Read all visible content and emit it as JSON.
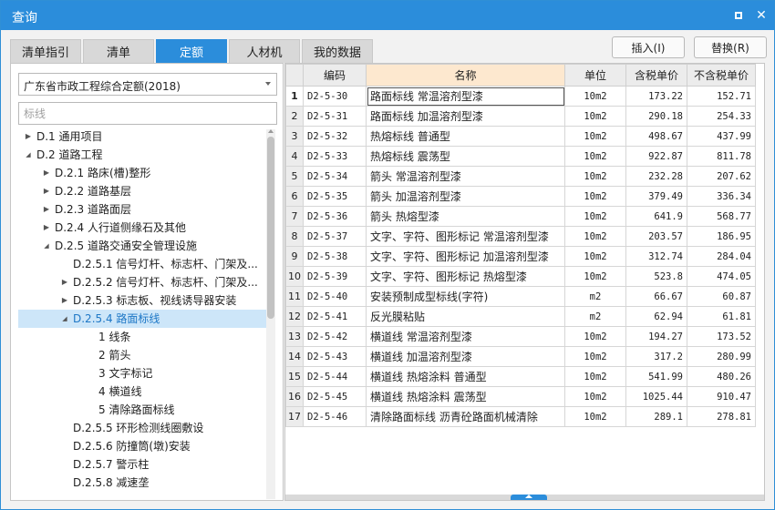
{
  "window": {
    "title": "查询"
  },
  "tabs": [
    {
      "label": "清单指引",
      "active": false
    },
    {
      "label": "清单",
      "active": false
    },
    {
      "label": "定额",
      "active": true
    },
    {
      "label": "人材机",
      "active": false
    },
    {
      "label": "我的数据",
      "active": false
    }
  ],
  "actions": {
    "insert_label": "插入(I)",
    "replace_label": "替换(R)"
  },
  "library": {
    "selected": "广东省市政工程综合定额(2018)"
  },
  "filter": {
    "placeholder": "标线"
  },
  "tree": [
    {
      "label": "D.1 通用项目",
      "level": 0,
      "arrow": "right"
    },
    {
      "label": "D.2 道路工程",
      "level": 0,
      "arrow": "down"
    },
    {
      "label": "D.2.1 路床(槽)整形",
      "level": 1,
      "arrow": "right"
    },
    {
      "label": "D.2.2 道路基层",
      "level": 1,
      "arrow": "right"
    },
    {
      "label": "D.2.3 道路面层",
      "level": 1,
      "arrow": "right"
    },
    {
      "label": "D.2.4 人行道侧缘石及其他",
      "level": 1,
      "arrow": "right"
    },
    {
      "label": "D.2.5 道路交通安全管理设施",
      "level": 1,
      "arrow": "down"
    },
    {
      "label": "D.2.5.1 信号灯杆、标志杆、门架及...",
      "level": 2,
      "arrow": "none"
    },
    {
      "label": "D.2.5.2 信号灯杆、标志杆、门架及...",
      "level": 2,
      "arrow": "right"
    },
    {
      "label": "D.2.5.3 标志板、视线诱导器安装",
      "level": 2,
      "arrow": "right"
    },
    {
      "label": "D.2.5.4 路面标线",
      "level": 2,
      "arrow": "down",
      "selected": true
    },
    {
      "label": "1 线条",
      "level": 3,
      "arrow": "none"
    },
    {
      "label": "2 箭头",
      "level": 3,
      "arrow": "none"
    },
    {
      "label": "3 文字标记",
      "level": 3,
      "arrow": "none"
    },
    {
      "label": "4 横道线",
      "level": 3,
      "arrow": "none"
    },
    {
      "label": "5 清除路面标线",
      "level": 3,
      "arrow": "none"
    },
    {
      "label": "D.2.5.5 环形检测线圈敷设",
      "level": 2,
      "arrow": "none"
    },
    {
      "label": "D.2.5.6 防撞筒(墩)安装",
      "level": 2,
      "arrow": "none"
    },
    {
      "label": "D.2.5.7 警示柱",
      "level": 2,
      "arrow": "none"
    },
    {
      "label": "D.2.5.8 减速垄",
      "level": 2,
      "arrow": "none"
    }
  ],
  "table": {
    "headers": [
      "",
      "编码",
      "名称",
      "单位",
      "含税单价",
      "不含税单价"
    ],
    "rows": [
      {
        "n": "1",
        "code": "D2-5-30",
        "name": "路面标线 常温溶剂型漆",
        "unit": "10m2",
        "tax": "173.22",
        "notax": "152.71",
        "current": true
      },
      {
        "n": "2",
        "code": "D2-5-31",
        "name": "路面标线 加温溶剂型漆",
        "unit": "10m2",
        "tax": "290.18",
        "notax": "254.33"
      },
      {
        "n": "3",
        "code": "D2-5-32",
        "name": "热熔标线 普通型",
        "unit": "10m2",
        "tax": "498.67",
        "notax": "437.99"
      },
      {
        "n": "4",
        "code": "D2-5-33",
        "name": "热熔标线 震荡型",
        "unit": "10m2",
        "tax": "922.87",
        "notax": "811.78"
      },
      {
        "n": "5",
        "code": "D2-5-34",
        "name": "箭头 常温溶剂型漆",
        "unit": "10m2",
        "tax": "232.28",
        "notax": "207.62"
      },
      {
        "n": "6",
        "code": "D2-5-35",
        "name": "箭头 加温溶剂型漆",
        "unit": "10m2",
        "tax": "379.49",
        "notax": "336.34"
      },
      {
        "n": "7",
        "code": "D2-5-36",
        "name": "箭头 热熔型漆",
        "unit": "10m2",
        "tax": "641.9",
        "notax": "568.77"
      },
      {
        "n": "8",
        "code": "D2-5-37",
        "name": "文字、字符、图形标记 常温溶剂型漆",
        "unit": "10m2",
        "tax": "203.57",
        "notax": "186.95"
      },
      {
        "n": "9",
        "code": "D2-5-38",
        "name": "文字、字符、图形标记 加温溶剂型漆",
        "unit": "10m2",
        "tax": "312.74",
        "notax": "284.04"
      },
      {
        "n": "10",
        "code": "D2-5-39",
        "name": "文字、字符、图形标记 热熔型漆",
        "unit": "10m2",
        "tax": "523.8",
        "notax": "474.05"
      },
      {
        "n": "11",
        "code": "D2-5-40",
        "name": "安装预制成型标线(字符)",
        "unit": "m2",
        "tax": "66.67",
        "notax": "60.87"
      },
      {
        "n": "12",
        "code": "D2-5-41",
        "name": "反光膜粘贴",
        "unit": "m2",
        "tax": "62.94",
        "notax": "61.81"
      },
      {
        "n": "13",
        "code": "D2-5-42",
        "name": "横道线 常温溶剂型漆",
        "unit": "10m2",
        "tax": "194.27",
        "notax": "173.52"
      },
      {
        "n": "14",
        "code": "D2-5-43",
        "name": "横道线 加温溶剂型漆",
        "unit": "10m2",
        "tax": "317.2",
        "notax": "280.99"
      },
      {
        "n": "15",
        "code": "D2-5-44",
        "name": "横道线 热熔涂料 普通型",
        "unit": "10m2",
        "tax": "541.99",
        "notax": "480.26"
      },
      {
        "n": "16",
        "code": "D2-5-45",
        "name": "横道线 热熔涂料 震荡型",
        "unit": "10m2",
        "tax": "1025.44",
        "notax": "910.47"
      },
      {
        "n": "17",
        "code": "D2-5-46",
        "name": "清除路面标线 沥青砼路面机械清除",
        "unit": "10m2",
        "tax": "289.1",
        "notax": "278.81"
      }
    ]
  }
}
